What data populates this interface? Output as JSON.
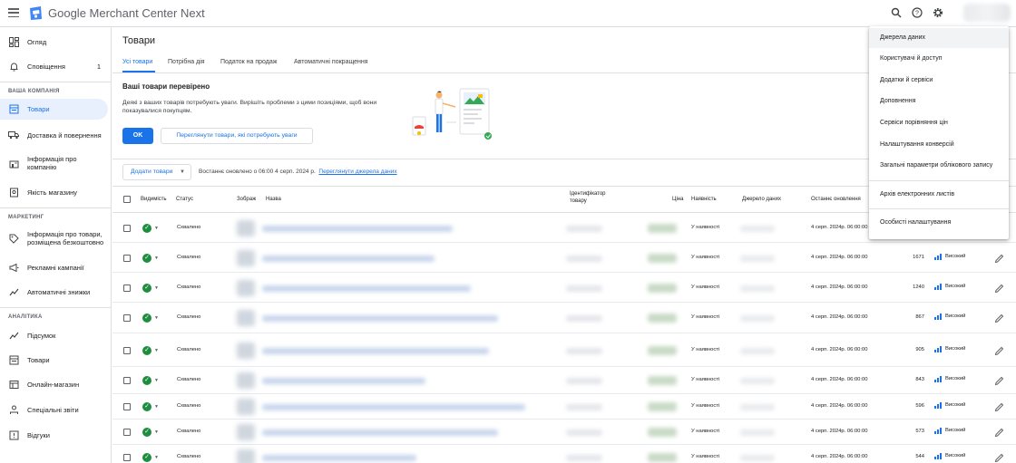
{
  "app": {
    "title": "Google Merchant Center Next"
  },
  "topbar": {
    "icons": [
      "search-icon",
      "help-icon",
      "gear-icon"
    ]
  },
  "sidebar": {
    "items_top": [
      {
        "label": "Огляд",
        "icon": "overview-icon"
      },
      {
        "label": "Сповіщення",
        "icon": "bell-icon",
        "count": "1"
      }
    ],
    "section_company": "ВАША КОМПАНІЯ",
    "items_company": [
      {
        "label": "Товари",
        "icon": "products-icon",
        "active": true
      },
      {
        "label": "Доставка й повернення",
        "icon": "truck-icon"
      },
      {
        "label": "Інформація про компанію",
        "icon": "store-icon"
      },
      {
        "label": "Якість магазину",
        "icon": "quality-icon"
      }
    ],
    "section_marketing": "МАРКЕТИНГ",
    "items_marketing": [
      {
        "label": "Інформація про товари, розміщена безкоштовно",
        "icon": "tag-icon"
      },
      {
        "label": "Рекламні кампанії",
        "icon": "megaphone-icon"
      },
      {
        "label": "Автоматичні знижки",
        "icon": "trend-icon"
      }
    ],
    "section_analytics": "АНАЛІТИКА",
    "items_analytics": [
      {
        "label": "Підсумок",
        "icon": "trend-icon"
      },
      {
        "label": "Товари",
        "icon": "products-icon"
      },
      {
        "label": "Онлайн-магазин",
        "icon": "storefront-icon"
      },
      {
        "label": "Спеціальні звіти",
        "icon": "reports-icon"
      },
      {
        "label": "Відгуки",
        "icon": "feedback-icon"
      }
    ]
  },
  "main": {
    "title": "Товари",
    "tabs": [
      "Усі товари",
      "Потрібна дія",
      "Податок на продаж",
      "Автоматичні покращення"
    ],
    "banner": {
      "title": "Ваші товари перевірено",
      "text": "Деякі з ваших товарів потребують уваги. Вирішіть проблеми з цими позиціями, щоб вони показувалися покупцям.",
      "ok": "OK",
      "review": "Переглянути товари, які потребують уваги"
    },
    "toolbar": {
      "add": "Додати товари",
      "updated": "Востаннє оновлено о 06:00 4 серп. 2024 р.",
      "link": "Переглянути джерела даних"
    },
    "table": {
      "headers": {
        "visibility": "Видимість",
        "status": "Статус",
        "image": "Зображ",
        "name": "Назва",
        "id": "Ідентифікатор товару",
        "price": "Ціна",
        "availability": "Наявність",
        "source": "Джерело даних",
        "updated": "Останнє оновлення"
      },
      "rows": [
        {
          "status": "Схвалено",
          "availability": "У наявності",
          "updated": "4 серп. 2024р. 06:00:00",
          "clicks": "",
          "level": ""
        },
        {
          "status": "Схвалено",
          "availability": "У наявності",
          "updated": "4 серп. 2024р. 06:00:00",
          "clicks": "1671",
          "level": "Високий"
        },
        {
          "status": "Схвалено",
          "availability": "У наявності",
          "updated": "4 серп. 2024р. 06:00:00",
          "clicks": "1240",
          "level": "Високий"
        },
        {
          "status": "Схвалено",
          "availability": "У наявності",
          "updated": "4 серп. 2024р. 06:00:00",
          "clicks": "867",
          "level": "Високий"
        },
        {
          "status": "Схвалено",
          "availability": "У наявності",
          "updated": "4 серп. 2024р. 06:00:00",
          "clicks": "905",
          "level": "Високий"
        },
        {
          "status": "Схвалено",
          "availability": "У наявності",
          "updated": "4 серп. 2024р. 06:00:00",
          "clicks": "843",
          "level": "Високий"
        },
        {
          "status": "Схвалено",
          "availability": "У наявності",
          "updated": "4 серп. 2024р. 06:00:00",
          "clicks": "596",
          "level": "Високий"
        },
        {
          "status": "Схвалено",
          "availability": "У наявності",
          "updated": "4 серп. 2024р. 06:00:00",
          "clicks": "573",
          "level": "Високий"
        },
        {
          "status": "Схвалено",
          "availability": "У наявності",
          "updated": "4 серп. 2024р. 06:00:00",
          "clicks": "544",
          "level": "Високий"
        }
      ]
    }
  },
  "settings_menu": {
    "items": [
      "Джерела даних",
      "Користувачі й доступ",
      "Додатки й сервіси",
      "Доповнення",
      "Сервіси порівняння цін",
      "Налаштування конверсій",
      "Загальні параметри облікового запису",
      "Архів електронних листів",
      "Особисті налаштування"
    ]
  },
  "colors": {
    "accent": "#1a73e8",
    "success": "#1e8e3e",
    "active_bg": "#e8f0fe"
  }
}
